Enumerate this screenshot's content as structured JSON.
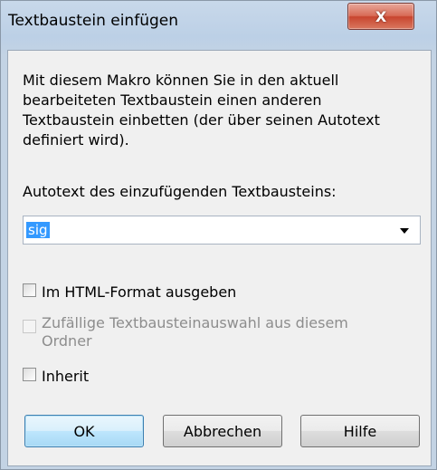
{
  "window": {
    "title": "Textbaustein einfügen",
    "close_glyph": "X"
  },
  "description": "Mit diesem Makro können Sie in den aktuell bearbeiteten Textbaustein einen anderen Textbaustein einbetten (der über seinen Autotext definiert wird).",
  "autotext": {
    "label": "Autotext des einzufügenden Textbausteins:",
    "value": "sig"
  },
  "options": {
    "html_format": {
      "label": "Im HTML-Format ausgeben",
      "checked": false,
      "enabled": true
    },
    "random_selection": {
      "label": "Zufällige Textbausteinauswahl aus diesem Ordner",
      "checked": false,
      "enabled": false
    },
    "inherit": {
      "label": "Inherit",
      "checked": false,
      "enabled": true
    }
  },
  "buttons": {
    "ok": "OK",
    "cancel": "Abbrechen",
    "help": "Hilfe"
  }
}
